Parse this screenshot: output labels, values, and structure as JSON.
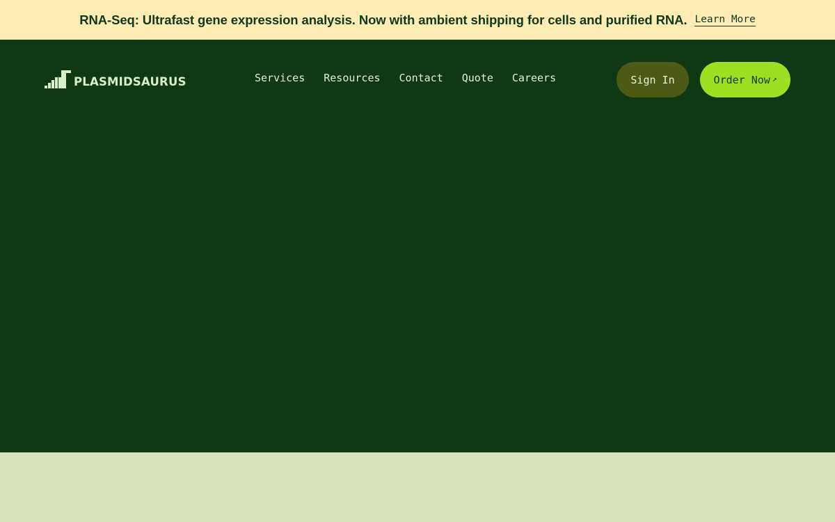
{
  "announcement": {
    "text": "RNA-Seq: Ultrafast gene expression analysis. Now with ambient shipping for cells and purified RNA.",
    "link_label": "Learn More"
  },
  "header": {
    "logo_text": "PLASMIDSAURUS",
    "nav": [
      {
        "label": "Services"
      },
      {
        "label": "Resources"
      },
      {
        "label": "Contact"
      },
      {
        "label": "Quote"
      },
      {
        "label": "Careers"
      }
    ],
    "sign_in_label": "Sign In",
    "order_label": "Order Now",
    "order_icon": "arrow-up-right-icon"
  },
  "colors": {
    "banner_bg": "#fdedb5",
    "hero_bg": "#0f3814",
    "accent": "#9ee021",
    "sign_in_bg": "#4d5a15",
    "lower_bg": "#d9e2bf"
  }
}
